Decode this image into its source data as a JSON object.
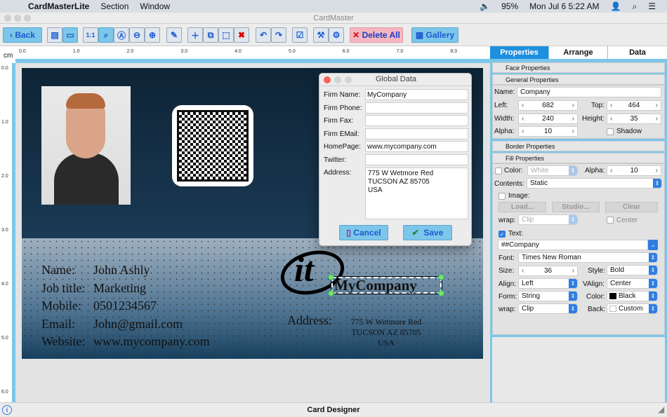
{
  "menubar": {
    "app": "CardMasterLite",
    "items": [
      "Section",
      "Window"
    ],
    "battery": "95%",
    "clock": "Mon Jul 6  5:22 AM"
  },
  "window": {
    "title": "CardMaster"
  },
  "toolbar": {
    "back": "Back",
    "zoom_1to1": "1:1",
    "delete_all": "Delete All",
    "gallery": "Gallery"
  },
  "ruler": {
    "unit": "cm",
    "h_ticks": [
      "0.0",
      "1.0",
      "2.0",
      "3.0",
      "4.0",
      "5.0",
      "6.0",
      "7.0",
      "8.0"
    ],
    "v_ticks": [
      "0.0",
      "1.0",
      "2.0",
      "3.0",
      "4.0",
      "5.0",
      "6.0"
    ]
  },
  "card": {
    "fields": [
      {
        "label": "Name:",
        "value": "John Ashly"
      },
      {
        "label": "Job title:",
        "value": "Marketing"
      },
      {
        "label": "Mobile:",
        "value": "0501234567"
      },
      {
        "label": "Email:",
        "value": "John@gmail.com"
      },
      {
        "label": "Website:",
        "value": "www.mycompany.com"
      }
    ],
    "company": "MyCompany",
    "address_label": "Address:",
    "address_lines": [
      "775 W Wetmore Red",
      "TUCSON AZ 85705",
      "USA"
    ]
  },
  "dialog": {
    "title": "Global Data",
    "fields": [
      {
        "label": "Firm Name:",
        "value": "MyCompany"
      },
      {
        "label": "Firm Phone:",
        "value": ""
      },
      {
        "label": "Firm Fax:",
        "value": ""
      },
      {
        "label": "Firm EMail:",
        "value": ""
      },
      {
        "label": "HomePage:",
        "value": "www.mycompany.com"
      },
      {
        "label": "Twitter:",
        "value": ""
      }
    ],
    "address_label": "Address:",
    "address": "775 W Wetmore Red\nTUCSON AZ 85705\nUSA",
    "cancel": "Cancel",
    "save": "Save"
  },
  "panel": {
    "tabs": [
      "Properties",
      "Arrange",
      "Data"
    ],
    "active_tab": "Properties",
    "sections": {
      "face": "Face Properties",
      "general": "General Properties",
      "border": "Border Properties",
      "fill": "Fill Properties"
    },
    "general": {
      "name_label": "Name:",
      "name": "Company",
      "left_label": "Left:",
      "left": "682",
      "top_label": "Top:",
      "top": "464",
      "width_label": "Width:",
      "width": "240",
      "height_label": "Height:",
      "height": "35",
      "alpha_label": "Alpha:",
      "alpha": "10",
      "shadow": "Shadow"
    },
    "fill": {
      "color_label": "Color:",
      "color": "White",
      "alpha_label": "Alpha:",
      "alpha": "10",
      "contents_label": "Contents:",
      "contents": "Static",
      "image": "Image:",
      "load": "Load...",
      "studio": "Studio...",
      "clear": "Clear",
      "wrap_label": "wrap:",
      "wrap": "Clip",
      "center": "Center",
      "text": "Text:",
      "text_value": "##Company",
      "font_label": "Font:",
      "font": "Times New Roman",
      "size_label": "Size:",
      "size": "36",
      "style_label": "Style:",
      "style": "Bold",
      "align_label": "Align:",
      "align": "Left",
      "valign_label": "VAlign:",
      "valign": "Center",
      "form_label": "Form:",
      "form": "String",
      "tcolor_label": "Color:",
      "tcolor": "Black",
      "twrap_label": "wrap:",
      "twrap": "Clip",
      "back_label": "Back:",
      "back": "Custom"
    }
  },
  "status": {
    "title": "Card Designer"
  },
  "colors": {
    "accent": "#7cc6ea",
    "selection": "#2f7de1",
    "delete": "#f5b6c1"
  }
}
